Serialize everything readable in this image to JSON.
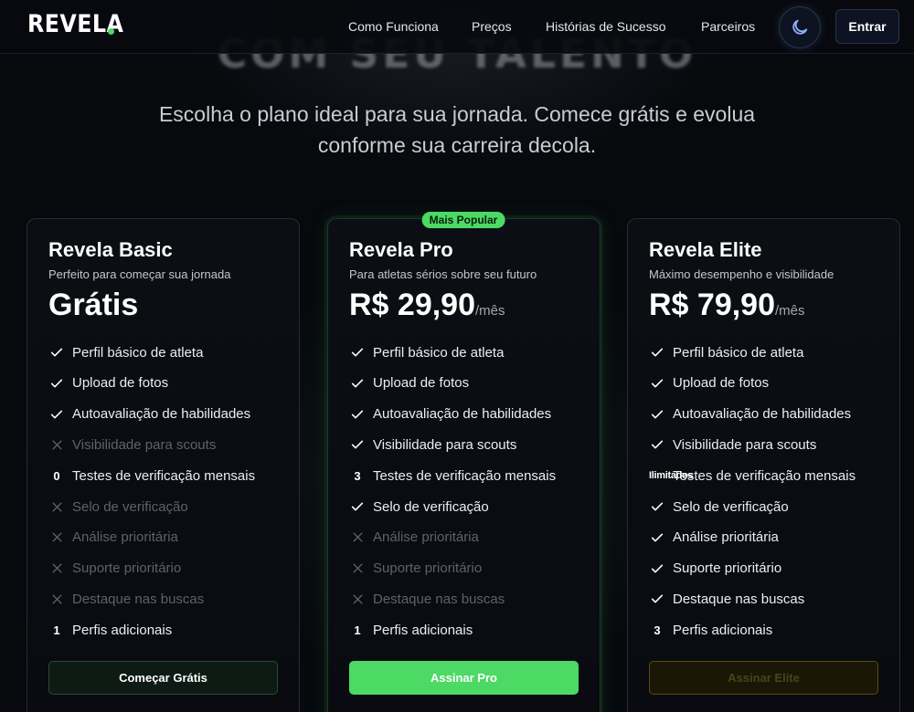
{
  "nav": {
    "logo": "REVELA",
    "links": [
      "Como Funciona",
      "Preços",
      "Histórias de Sucesso",
      "Parceiros"
    ],
    "theme_toggle_icon": "moon-icon",
    "login_label": "Entrar"
  },
  "hero": {
    "title_partial": "COM SEU TALENTO",
    "subtitle_line1": "Escolha o plano ideal para sua jornada. Comece grátis e evolua",
    "subtitle_line2": "conforme sua carreira decola."
  },
  "colors": {
    "accent": "#4cd964",
    "background": "#07090d",
    "elite_button": "#5a4d0c"
  },
  "plans": [
    {
      "name": "Revela Basic",
      "description": "Perfeito para começar sua jornada",
      "price": "Grátis",
      "period": "",
      "cta": "Começar Grátis",
      "features": [
        {
          "icon": "check",
          "label": "Perfil básico de atleta"
        },
        {
          "icon": "check",
          "label": "Upload de fotos"
        },
        {
          "icon": "check",
          "label": "Autoavaliação de habilidades"
        },
        {
          "icon": "cross",
          "label": "Visibilidade para scouts"
        },
        {
          "icon": "number",
          "value": "0",
          "label": "Testes de verificação mensais"
        },
        {
          "icon": "cross",
          "label": "Selo de verificação"
        },
        {
          "icon": "cross",
          "label": "Análise prioritária"
        },
        {
          "icon": "cross",
          "label": "Suporte prioritário"
        },
        {
          "icon": "cross",
          "label": "Destaque nas buscas"
        },
        {
          "icon": "number",
          "value": "1",
          "label": "Perfis adicionais"
        }
      ]
    },
    {
      "name": "Revela Pro",
      "badge": "Mais Popular",
      "description": "Para atletas sérios sobre seu futuro",
      "price": "R$ 29,90",
      "period": "/mês",
      "cta": "Assinar Pro",
      "features": [
        {
          "icon": "check",
          "label": "Perfil básico de atleta"
        },
        {
          "icon": "check",
          "label": "Upload de fotos"
        },
        {
          "icon": "check",
          "label": "Autoavaliação de habilidades"
        },
        {
          "icon": "check",
          "label": "Visibilidade para scouts"
        },
        {
          "icon": "number",
          "value": "3",
          "label": "Testes de verificação mensais"
        },
        {
          "icon": "check",
          "label": "Selo de verificação"
        },
        {
          "icon": "cross",
          "label": "Análise prioritária"
        },
        {
          "icon": "cross",
          "label": "Suporte prioritário"
        },
        {
          "icon": "cross",
          "label": "Destaque nas buscas"
        },
        {
          "icon": "number",
          "value": "1",
          "label": "Perfis adicionais"
        }
      ]
    },
    {
      "name": "Revela Elite",
      "description": "Máximo desempenho e visibilidade",
      "price": "R$ 79,90",
      "period": "/mês",
      "cta": "Assinar Elite",
      "features": [
        {
          "icon": "check",
          "label": "Perfil básico de atleta"
        },
        {
          "icon": "check",
          "label": "Upload de fotos"
        },
        {
          "icon": "check",
          "label": "Autoavaliação de habilidades"
        },
        {
          "icon": "check",
          "label": "Visibilidade para scouts"
        },
        {
          "icon": "number",
          "value": "Ilimitados",
          "label": "Testes de verificação mensais"
        },
        {
          "icon": "check",
          "label": "Selo de verificação"
        },
        {
          "icon": "check",
          "label": "Análise prioritária"
        },
        {
          "icon": "check",
          "label": "Suporte prioritário"
        },
        {
          "icon": "check",
          "label": "Destaque nas buscas"
        },
        {
          "icon": "number",
          "value": "3",
          "label": "Perfis adicionais"
        }
      ]
    }
  ]
}
